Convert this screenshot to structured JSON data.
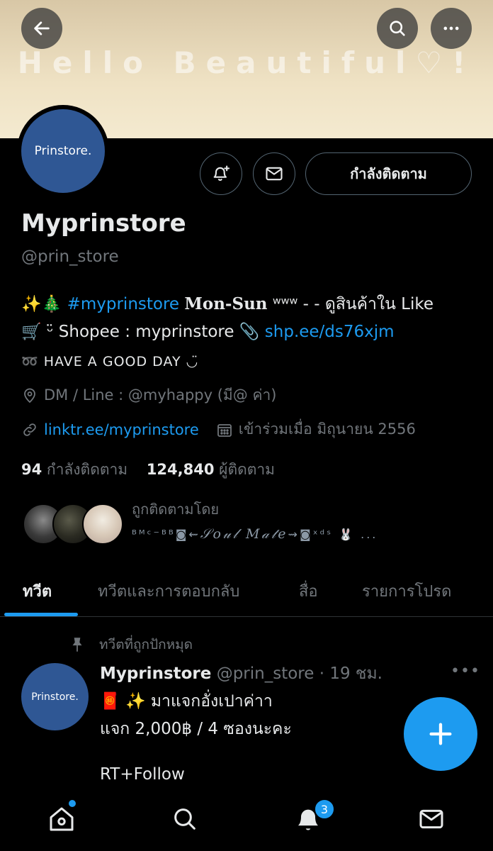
{
  "banner": {
    "text": "Hello Beautiful♡!"
  },
  "profile": {
    "avatar_text": "Prinstore.",
    "display_name": "Myprinstore",
    "handle": "@prin_store",
    "following_button": "กำลังติดตาม",
    "bio": {
      "line1_emoji": "✨🎄",
      "line1_hashtag": "#myprinstore",
      "line1_days": "Mon-Sun",
      "line1_rest": "ʷʷʷ - - ดูสินค้าใน Like",
      "line2_prefix": "🛒 ᵕ̈ Shopee : myprinstore 📎",
      "line2_link": "shp.ee/ds76xjm",
      "line3": "➿ HAVE A GOOD DAY ◡̈"
    },
    "location": "DM / Line : @myhappy (มี@ ค่า)",
    "website": "linktr.ee/myprinstore",
    "joined": "เข้าร่วมเมื่อ มิถุนายน 2556",
    "following_count": "94",
    "following_label": "กำลังติดตาม",
    "followers_count": "124,840",
    "followers_label": "ผู้ติดตาม",
    "followed_by_label": "ถูกติดตามโดย",
    "followed_by_names_a": "ᴮᴹᶜ⁻ᴮᴮ◙⇜",
    "followed_by_names_b": "𝒮𝑜𝓊𝓁 𝑀𝒶𝓉𝑒",
    "followed_by_names_c": "⇝◙ˣᵈˢ 🐰 ..."
  },
  "tabs": [
    {
      "label": "ทวีต"
    },
    {
      "label": "ทวีตและการตอบกลับ"
    },
    {
      "label": "สื่อ"
    },
    {
      "label": "รายการโปรด"
    }
  ],
  "tweet": {
    "pinned_label": "ทวีตที่ถูกปักหมุด",
    "avatar_text": "Prinstore.",
    "author_name": "Myprinstore",
    "author_meta": "@prin_store · 19 ชม.",
    "more": "•••",
    "line1": "🧧 ✨ มาแจกอั่งเปาค่าา",
    "line2": "แจก 2,000฿ / 4 ซองนะคะ",
    "line3": "RT+Follow"
  },
  "nav": {
    "notifications_badge": "3"
  },
  "colors": {
    "accent": "#1d9bf0",
    "avatar_blue": "#2f5794",
    "background": "#000000"
  }
}
